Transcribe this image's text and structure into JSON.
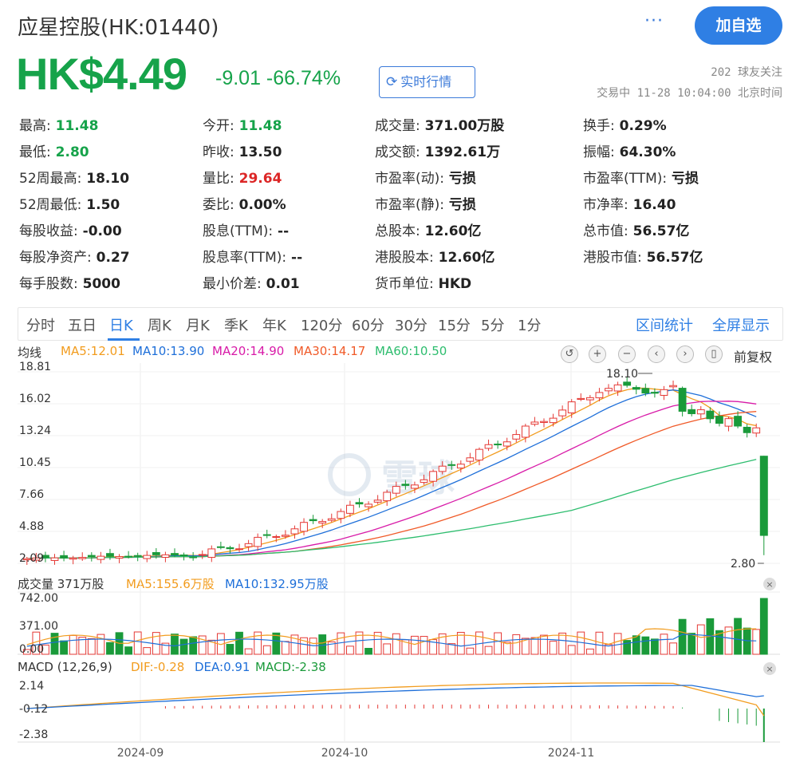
{
  "header": {
    "title": "应星控股(HK:01440)",
    "more_label": "···",
    "follow_label": "加自选",
    "price": "HK$4.49",
    "change": "-9.01 -66.74%",
    "realtime_label": "实时行情",
    "followers": "202 球友关注",
    "status": "交易中 11-28 10:04:00 北京时间"
  },
  "quote": [
    [
      {
        "k": "最高:",
        "v": "11.48",
        "c": "green"
      },
      {
        "k": "今开:",
        "v": "11.48",
        "c": "green"
      },
      {
        "k": "成交量:",
        "v": "371.00万股",
        "c": ""
      },
      {
        "k": "换手:",
        "v": "0.29%",
        "c": ""
      }
    ],
    [
      {
        "k": "最低:",
        "v": "2.80",
        "c": "green"
      },
      {
        "k": "昨收:",
        "v": "13.50",
        "c": ""
      },
      {
        "k": "成交额:",
        "v": "1392.61万",
        "c": ""
      },
      {
        "k": "振幅:",
        "v": "64.30%",
        "c": ""
      }
    ],
    [
      {
        "k": "52周最高:",
        "v": "18.10",
        "c": ""
      },
      {
        "k": "量比:",
        "v": "29.64",
        "c": "red"
      },
      {
        "k": "市盈率(动):",
        "v": "亏损",
        "c": ""
      },
      {
        "k": "市盈率(TTM):",
        "v": "亏损",
        "c": ""
      }
    ],
    [
      {
        "k": "52周最低:",
        "v": "1.50",
        "c": ""
      },
      {
        "k": "委比:",
        "v": "0.00%",
        "c": ""
      },
      {
        "k": "市盈率(静):",
        "v": "亏损",
        "c": ""
      },
      {
        "k": "市净率:",
        "v": "16.40",
        "c": ""
      }
    ],
    [
      {
        "k": "每股收益:",
        "v": "-0.00",
        "c": ""
      },
      {
        "k": "股息(TTM):",
        "v": "--",
        "c": ""
      },
      {
        "k": "总股本:",
        "v": "12.60亿",
        "c": ""
      },
      {
        "k": "总市值:",
        "v": "56.57亿",
        "c": ""
      }
    ],
    [
      {
        "k": "每股净资产:",
        "v": "0.27",
        "c": ""
      },
      {
        "k": "股息率(TTM):",
        "v": "--",
        "c": ""
      },
      {
        "k": "港股股本:",
        "v": "12.60亿",
        "c": ""
      },
      {
        "k": "港股市值:",
        "v": "56.57亿",
        "c": ""
      }
    ],
    [
      {
        "k": "每手股数:",
        "v": "5000",
        "c": ""
      },
      {
        "k": "最小价差:",
        "v": "0.01",
        "c": ""
      },
      {
        "k": "货币单位:",
        "v": "HKD",
        "c": ""
      }
    ]
  ],
  "tabs": [
    "分时",
    "五日",
    "日K",
    "周K",
    "月K",
    "季K",
    "年K",
    "120分",
    "60分",
    "30分",
    "15分",
    "5分",
    "1分"
  ],
  "active_tab": "日K",
  "tools": {
    "range_stats": "区间统计",
    "fullscreen": "全屏显示",
    "rights": "前复权"
  },
  "legend": {
    "ma_label": "均线",
    "ma5": "MA5:12.01",
    "ma10": "MA10:13.90",
    "ma20": "MA20:14.90",
    "ma30": "MA30:14.17",
    "ma60": "MA60:10.50",
    "vol_label": "成交量 371万股",
    "vol_ma5": "MA5:155.6万股",
    "vol_ma10": "MA10:132.95万股",
    "macd_label": "MACD (12,26,9)",
    "dif": "DIF:-0.28",
    "dea": "DEA:0.91",
    "macd": "MACD:-2.38"
  },
  "colors": {
    "up": "#e53935",
    "down": "#1a9a3a",
    "ma5": "#f29c1e",
    "ma10": "#1e6fd9",
    "ma20": "#d81ba8",
    "ma30": "#f05a28",
    "ma60": "#2dbd6e"
  },
  "chart_data": {
    "type": "candlestick",
    "price_axis": [
      "18.81",
      "16.02",
      "13.24",
      "10.45",
      "7.66",
      "4.88",
      "2.09"
    ],
    "price_ylim": [
      2.09,
      18.81
    ],
    "high_label": "18.10",
    "low_label": "2.80",
    "x_labels": [
      "2024-09",
      "2024-10",
      "2024-11"
    ],
    "volume_axis": [
      "742.00",
      "371.00",
      "0.00"
    ],
    "macd_axis": [
      "2.14",
      "-0.12",
      "-2.38"
    ],
    "last_candle": {
      "open": 11.48,
      "high": 11.48,
      "low": 2.8,
      "close": 4.49
    }
  }
}
